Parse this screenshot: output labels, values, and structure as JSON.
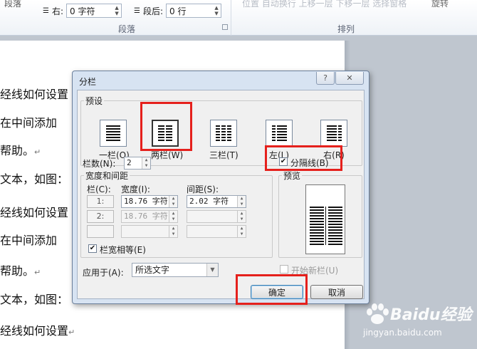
{
  "ribbon": {
    "right_indent_label": "右:",
    "right_indent_value": "0 字符",
    "space_after_label": "段后:",
    "space_after_value": "0 行",
    "paragraph_group": "段落",
    "arrange_group": "排列",
    "partial_top_left": "段落",
    "faded_items": "位置   自动换行   上移一层   下移一层   选择窗格",
    "rotate_label": "旋转"
  },
  "document": {
    "lines": [
      "经线如何设置",
      "在中间添加",
      "帮助。",
      "文本，如图：",
      "经线如何设置",
      "在中间添加",
      "帮助。",
      "文本，如图：",
      "经线如何设置"
    ],
    "para_mark": "↵"
  },
  "dialog": {
    "title": "分栏",
    "help_label": "?",
    "close_label": "✕",
    "presets_label": "预设",
    "presets": [
      {
        "label": "一栏(O)"
      },
      {
        "label": "两栏(W)"
      },
      {
        "label": "三栏(T)"
      },
      {
        "label": "左(L)"
      },
      {
        "label": "右(R)"
      }
    ],
    "selected_preset": "两栏(W)",
    "num_columns_label": "栏数(N):",
    "num_columns_value": "2",
    "separator_label": "分隔线(B)",
    "separator_checked": true,
    "width_spacing_label": "宽度和间距",
    "col_header": "栏(C):",
    "width_header": "宽度(I):",
    "spacing_header": "间距(S):",
    "rows": [
      {
        "col": "1:",
        "width": "18.76 字符",
        "spacing": "2.02 字符"
      },
      {
        "col": "2:",
        "width": "18.76 字符",
        "spacing": ""
      },
      {
        "col": "",
        "width": "",
        "spacing": ""
      }
    ],
    "equal_width_label": "栏宽相等(E)",
    "equal_width_checked": true,
    "preview_label": "预览",
    "apply_to_label": "应用于(A):",
    "apply_to_value": "所选文字",
    "new_column_label": "开始新栏(U)",
    "new_column_checked": false,
    "ok_label": "确定",
    "cancel_label": "取消"
  },
  "watermark": {
    "brand": "Baidu经验",
    "url": "jingyan.baidu.com"
  },
  "colors": {
    "highlight": "#e5201c",
    "dialog_frame": "#d7e3f2",
    "dialog_body": "#f0f0f0"
  }
}
